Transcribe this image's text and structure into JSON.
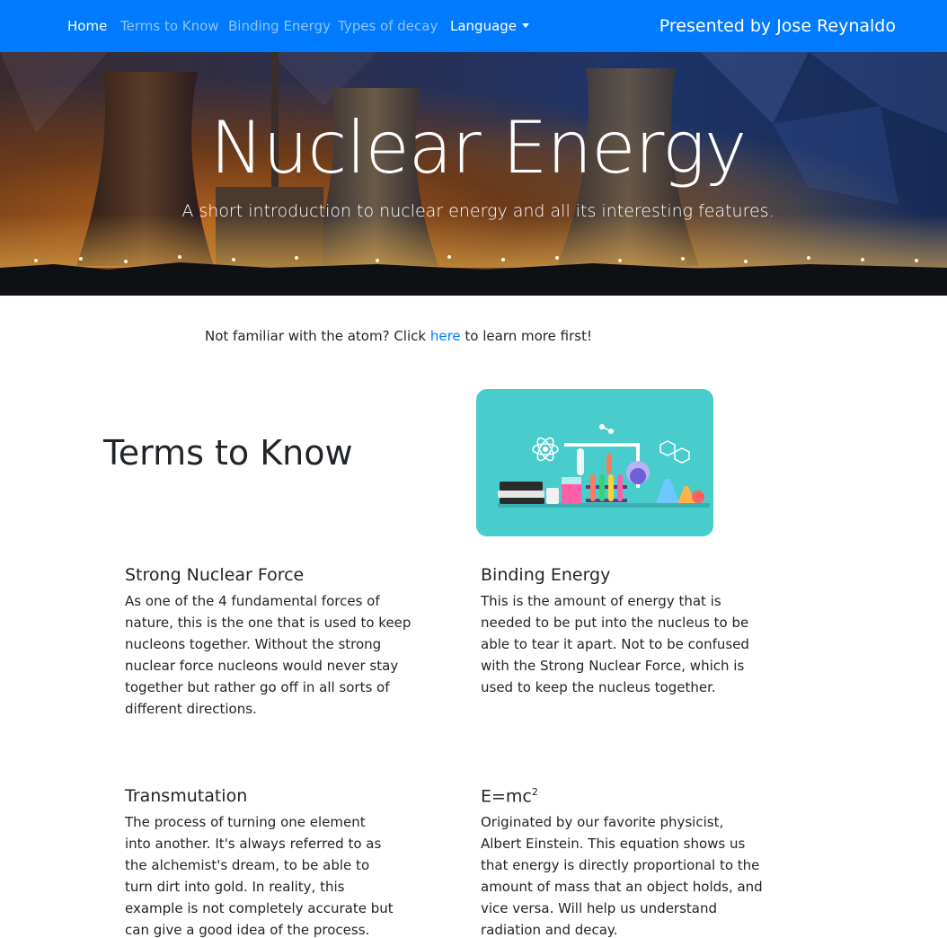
{
  "nav": {
    "items": [
      {
        "label": "Home"
      },
      {
        "label": "Terms to Know"
      },
      {
        "label": "Binding Energy"
      },
      {
        "label": "Types of decay"
      }
    ],
    "dropdown_label": "Language",
    "presenter": "Presented by Jose Reynaldo",
    "bg_color": "#007bff"
  },
  "hero": {
    "title": "Nuclear Energy",
    "subtitle": "A short introduction to nuclear energy and all its interesting features."
  },
  "intro": {
    "before": "Not familiar with the atom? Click ",
    "link": "here",
    "after": " to learn more first!"
  },
  "terms_section": {
    "title": "Terms to Know",
    "items": [
      {
        "title": "Strong Nuclear Force",
        "body": "As one of the 4 fundamental forces of nature, this is the one that is used to keep nucleons together. Without the strong nuclear force nucleons would never stay together but rather go off in all sorts of different directions."
      },
      {
        "title": "Binding Energy",
        "body": "This is the amount of energy that is needed to be put into the nucleus to be able to tear it apart. Not to be confused with the Strong Nuclear Force, which is used to keep the nucleus together."
      },
      {
        "title": "Transmutation",
        "body": "The process of turning one element into another. It's always referred to as the alchemist's dream, to be able to turn dirt into gold. In reality, this example is not completely accurate but can give a good idea of the process."
      },
      {
        "title_base": "E=mc",
        "title_sup": "2",
        "body": "Originated by our favorite physicist, Albert Einstein. This equation shows us that energy is directly proportional to the amount of mass that an object holds, and vice versa. Will help us understand radiation and decay."
      }
    ]
  },
  "colors": {
    "link": "#007bff",
    "illustration_bg": "#49cccc"
  }
}
